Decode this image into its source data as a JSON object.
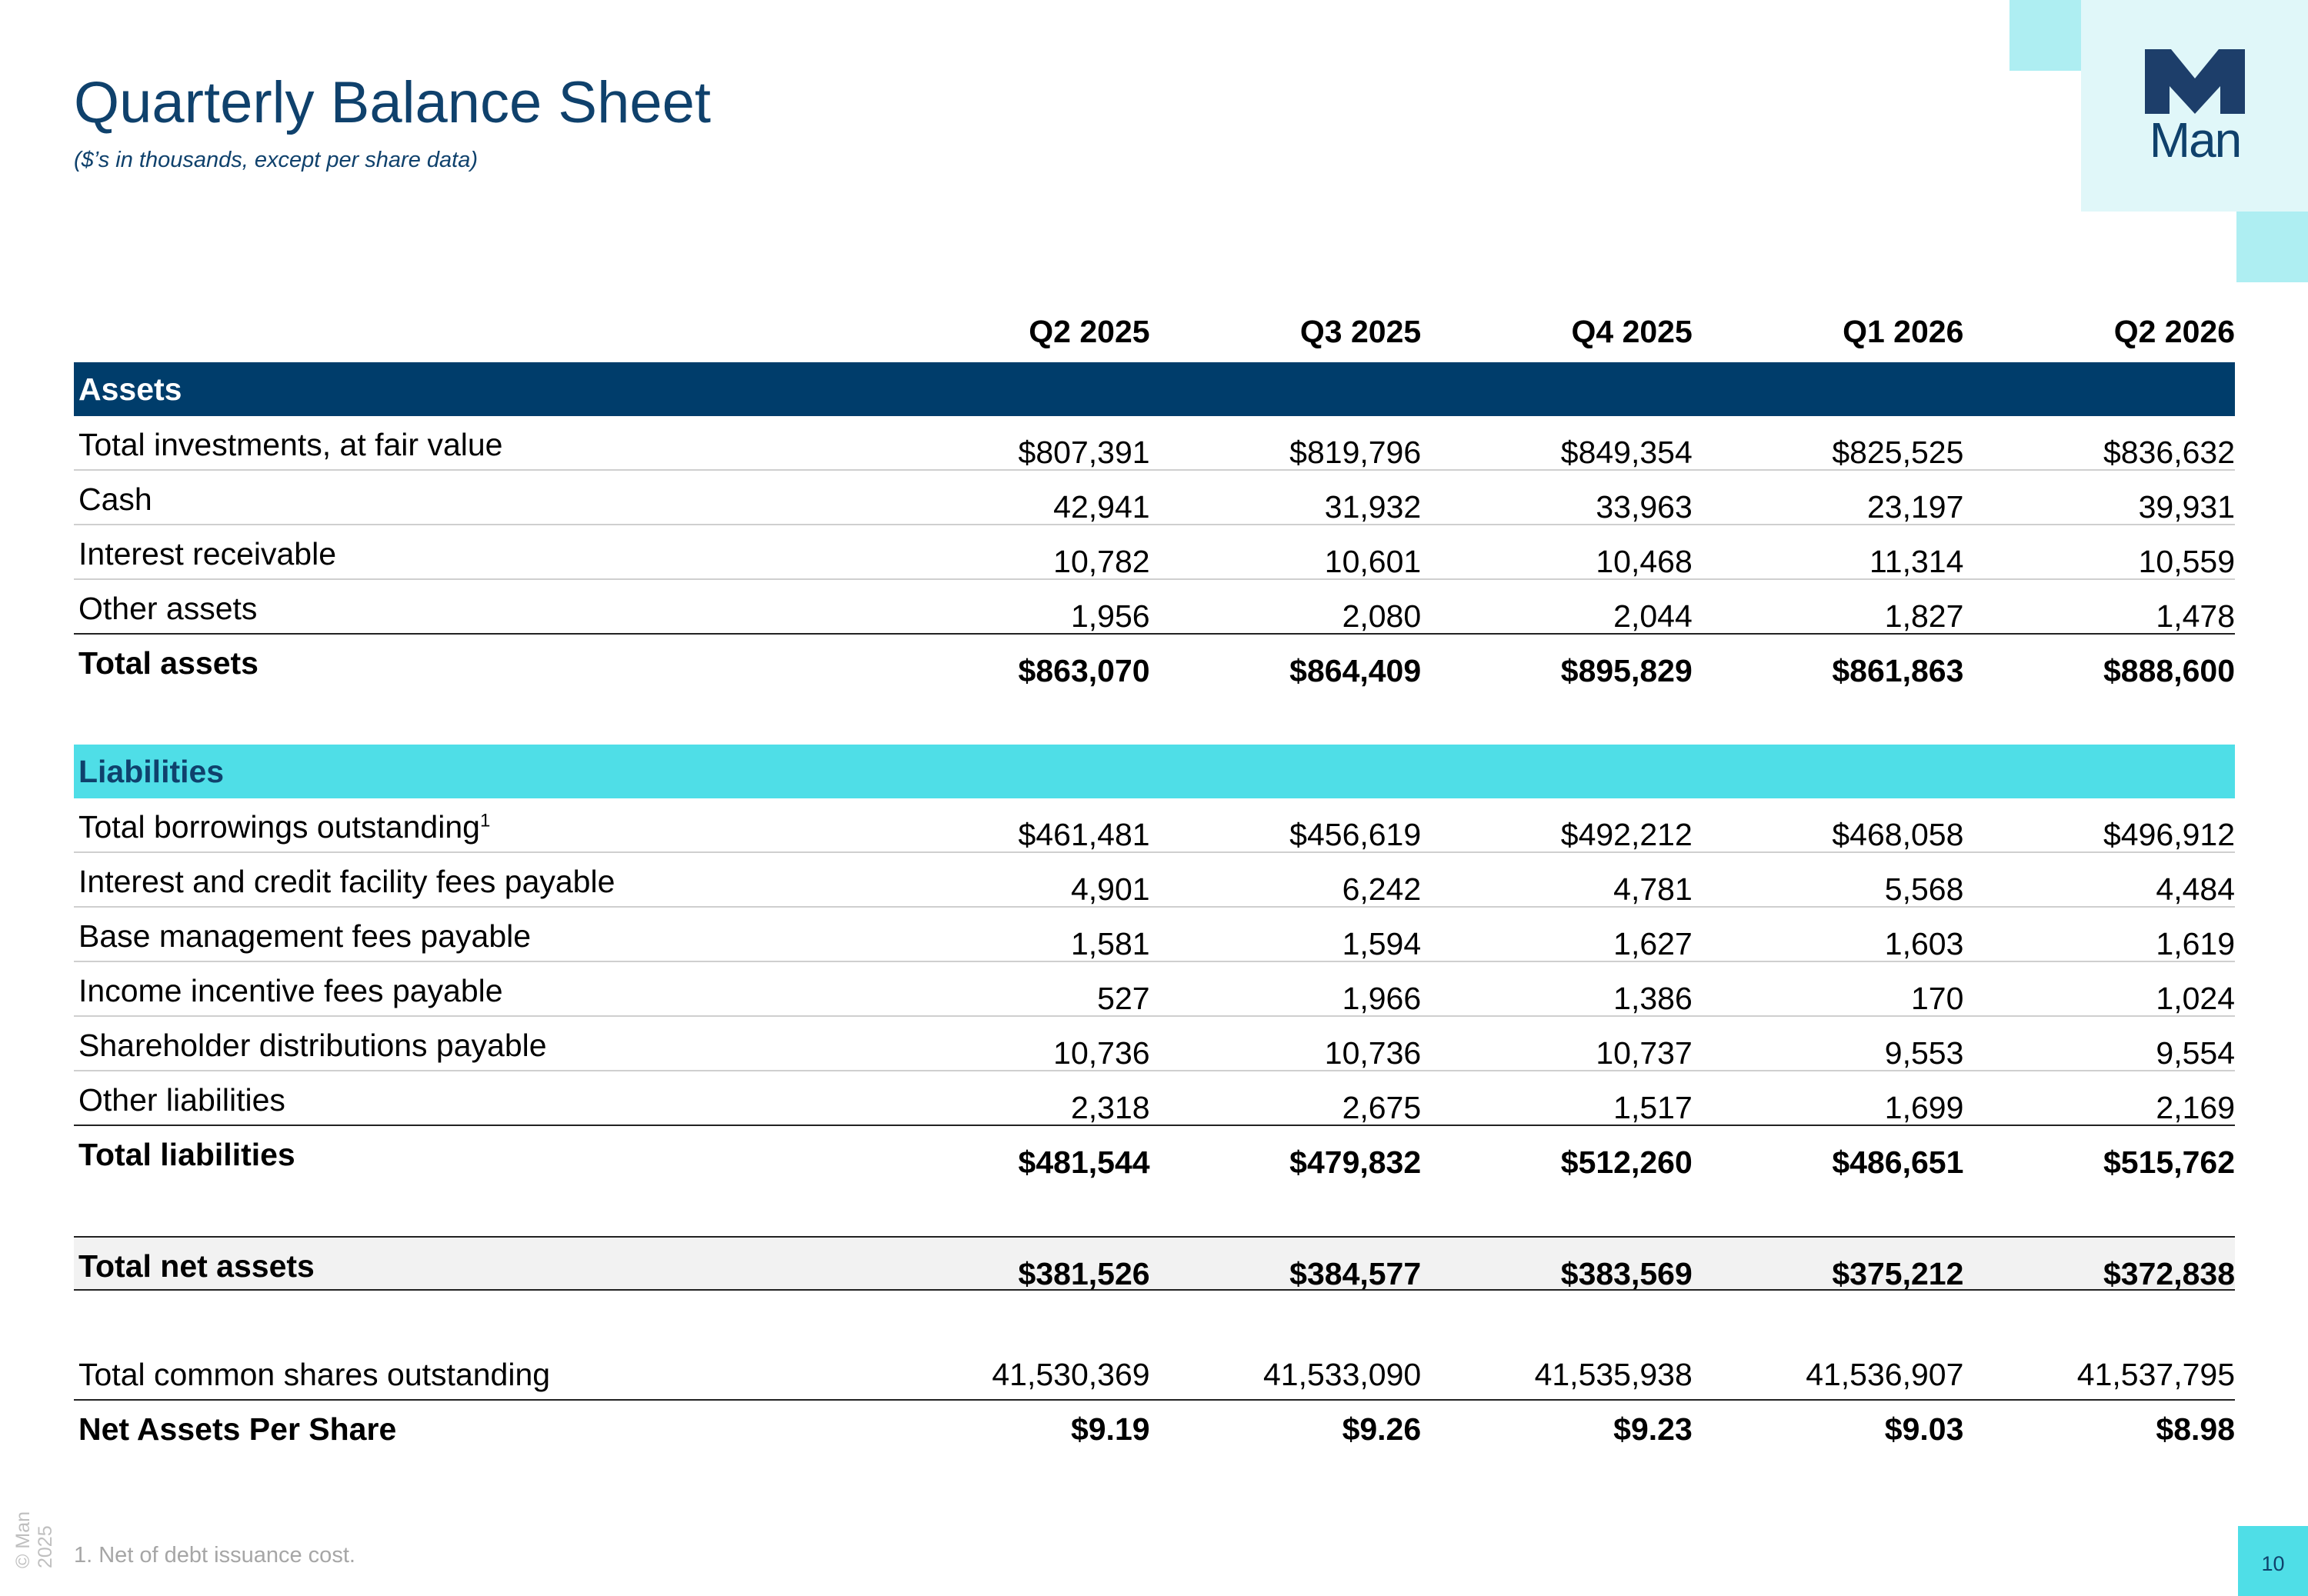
{
  "header": {
    "title": "Quarterly Balance Sheet",
    "subtitle": "($’s in thousands, except per share data)"
  },
  "logo": {
    "text": "Man",
    "icon": "m-logo-icon"
  },
  "columns": [
    "Q2 2025",
    "Q3 2025",
    "Q4 2025",
    "Q1 2026",
    "Q2 2026"
  ],
  "assets": {
    "heading": "Assets",
    "rows": [
      {
        "label": "Total investments, at fair value",
        "values": [
          "$807,391",
          "$819,796",
          "$849,354",
          "$825,525",
          "$836,632"
        ]
      },
      {
        "label": "Cash",
        "values": [
          "42,941",
          "31,932",
          "33,963",
          "23,197",
          "39,931"
        ]
      },
      {
        "label": "Interest receivable",
        "values": [
          "10,782",
          "10,601",
          "10,468",
          "11,314",
          "10,559"
        ]
      },
      {
        "label": "Other assets",
        "values": [
          "1,956",
          "2,080",
          "2,044",
          "1,827",
          "1,478"
        ]
      }
    ],
    "total": {
      "label": "Total assets",
      "values": [
        "$863,070",
        "$864,409",
        "$895,829",
        "$861,863",
        "$888,600"
      ]
    }
  },
  "liabilities": {
    "heading": "Liabilities",
    "rows": [
      {
        "label": "Total borrowings outstanding",
        "footnote_ref": "1",
        "values": [
          "$461,481",
          "$456,619",
          "$492,212",
          "$468,058",
          "$496,912"
        ]
      },
      {
        "label": "Interest and credit facility fees payable",
        "values": [
          "4,901",
          "6,242",
          "4,781",
          "5,568",
          "4,484"
        ]
      },
      {
        "label": "Base management fees payable",
        "values": [
          "1,581",
          "1,594",
          "1,627",
          "1,603",
          "1,619"
        ]
      },
      {
        "label": "Income incentive fees payable",
        "values": [
          "527",
          "1,966",
          "1,386",
          "170",
          "1,024"
        ]
      },
      {
        "label": "Shareholder distributions payable",
        "values": [
          "10,736",
          "10,736",
          "10,737",
          "9,553",
          "9,554"
        ]
      },
      {
        "label": "Other liabilities",
        "values": [
          "2,318",
          "2,675",
          "1,517",
          "1,699",
          "2,169"
        ]
      }
    ],
    "total": {
      "label": "Total liabilities",
      "values": [
        "$481,544",
        "$479,832",
        "$512,260",
        "$486,651",
        "$515,762"
      ]
    }
  },
  "net_assets": {
    "label": "Total net assets",
    "values": [
      "$381,526",
      "$384,577",
      "$383,569",
      "$375,212",
      "$372,838"
    ]
  },
  "shares": {
    "label": "Total common shares outstanding",
    "values": [
      "41,530,369",
      "41,533,090",
      "41,535,938",
      "41,536,907",
      "41,537,795"
    ]
  },
  "nav_per_share": {
    "label": "Net Assets Per Share",
    "values": [
      "$9.19",
      "$9.26",
      "$9.23",
      "$9.03",
      "$8.98"
    ]
  },
  "footer": {
    "footnote": "1. Net of debt issuance cost.",
    "copyright": "© Man 2025",
    "page_number": "10"
  },
  "colors": {
    "navy": "#0f416c",
    "dark_band": "#003d6b",
    "teal_band": "#4fdee7",
    "light_teal": "#aeeef2",
    "pale_teal": "#e0f7f9"
  }
}
